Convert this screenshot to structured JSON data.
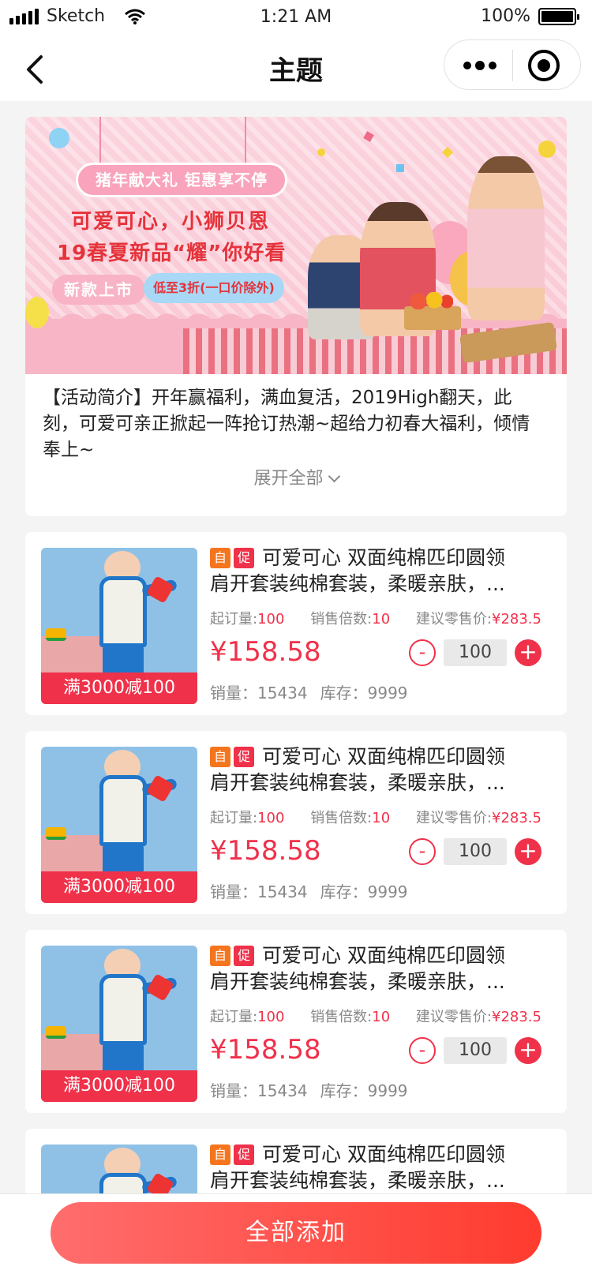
{
  "status_bar": {
    "carrier": "Sketch",
    "time": "1:21 AM",
    "battery": "100%"
  },
  "nav": {
    "title": "主题"
  },
  "activity": {
    "banner": {
      "tag": "猪年献大礼 钜惠享不停",
      "line1": "可爱可心，小狮贝恩",
      "line2": "19春夏新品“耀”你好看",
      "new_label": "新款上市",
      "discount": "低至3折(一口价除外)"
    },
    "intro": "【活动简介】开年赢福利，满血复活，2019High翻天，此刻，可爱可亲正掀起一阵抢订热潮~超给力初春大福利，倾情奉上~",
    "expand_label": "展开全部"
  },
  "products": [
    {
      "badge_self": "自",
      "badge_promo": "促",
      "name_line1": "可爱可心 双面纯棉匹印圆领",
      "name_line2": "肩开套装纯棉套装，柔暖亲肤，...",
      "moq_label": "起订量:",
      "moq": "100",
      "multiple_label": "销售倍数:",
      "multiple": "10",
      "retail_label": "建议零售价:",
      "retail": "¥283.5",
      "price": "¥158.58",
      "qty": "100",
      "sales": "销量：15434",
      "stock": "库存：9999",
      "promo": "满3000减100"
    },
    {
      "badge_self": "自",
      "badge_promo": "促",
      "name_line1": "可爱可心 双面纯棉匹印圆领",
      "name_line2": "肩开套装纯棉套装，柔暖亲肤，...",
      "moq_label": "起订量:",
      "moq": "100",
      "multiple_label": "销售倍数:",
      "multiple": "10",
      "retail_label": "建议零售价:",
      "retail": "¥283.5",
      "price": "¥158.58",
      "qty": "100",
      "sales": "销量：15434",
      "stock": "库存：9999",
      "promo": "满3000减100"
    },
    {
      "badge_self": "自",
      "badge_promo": "促",
      "name_line1": "可爱可心 双面纯棉匹印圆领",
      "name_line2": "肩开套装纯棉套装，柔暖亲肤，...",
      "moq_label": "起订量:",
      "moq": "100",
      "multiple_label": "销售倍数:",
      "multiple": "10",
      "retail_label": "建议零售价:",
      "retail": "¥283.5",
      "price": "¥158.58",
      "qty": "100",
      "sales": "销量：15434",
      "stock": "库存：9999",
      "promo": "满3000减100"
    },
    {
      "badge_self": "自",
      "badge_promo": "促",
      "name_line1": "可爱可心 双面纯棉匹印圆领",
      "name_line2": "肩开套装纯棉套装，柔暖亲肤，..."
    }
  ],
  "stepper": {
    "minus": "-",
    "plus": "+"
  },
  "bottom": {
    "add_all_label": "全部添加"
  },
  "colors": {
    "accent": "#f0314a",
    "self_badge": "#f5751e",
    "button_gradient_start": "#ff6d6d",
    "button_gradient_end": "#ff3b2e"
  },
  "icons": {
    "back": "chevron-left-icon",
    "more": "more-dots-icon",
    "close": "target-circle-icon",
    "expand": "chevron-down-icon"
  }
}
